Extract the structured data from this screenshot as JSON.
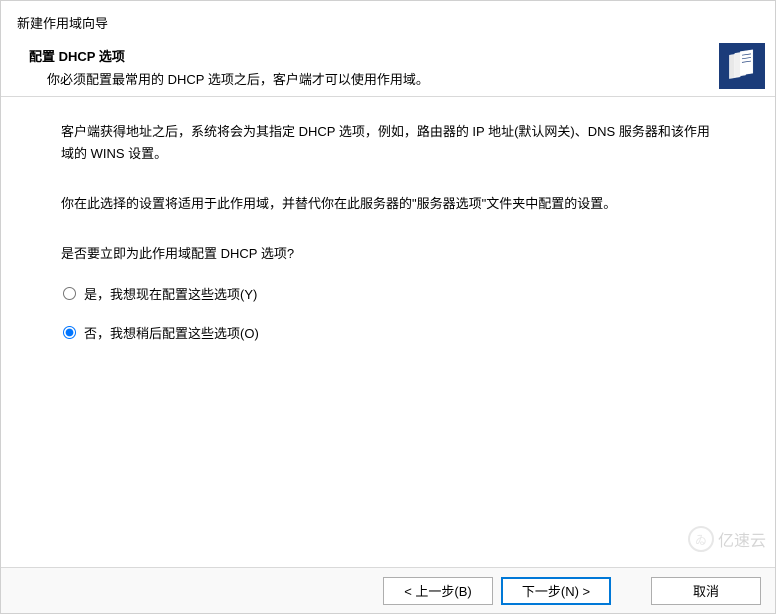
{
  "header": {
    "wizard_title": "新建作用域向导",
    "subtitle": "配置 DHCP 选项",
    "description": "你必须配置最常用的 DHCP 选项之后，客户端才可以使用作用域。"
  },
  "content": {
    "paragraph1": "客户端获得地址之后，系统将会为其指定 DHCP 选项，例如，路由器的 IP 地址(默认网关)、DNS 服务器和该作用域的 WINS 设置。",
    "paragraph2": "你在此选择的设置将适用于此作用域，并替代你在此服务器的\"服务器选项\"文件夹中配置的设置。",
    "question": "是否要立即为此作用域配置 DHCP 选项?",
    "options": {
      "yes_label": "是，我想现在配置这些选项(Y)",
      "no_label": "否，我想稍后配置这些选项(O)",
      "selected": "no"
    }
  },
  "footer": {
    "back_label": "< 上一步(B)",
    "next_label": "下一步(N) >",
    "cancel_label": "取消"
  },
  "watermark": {
    "text": "亿速云"
  }
}
